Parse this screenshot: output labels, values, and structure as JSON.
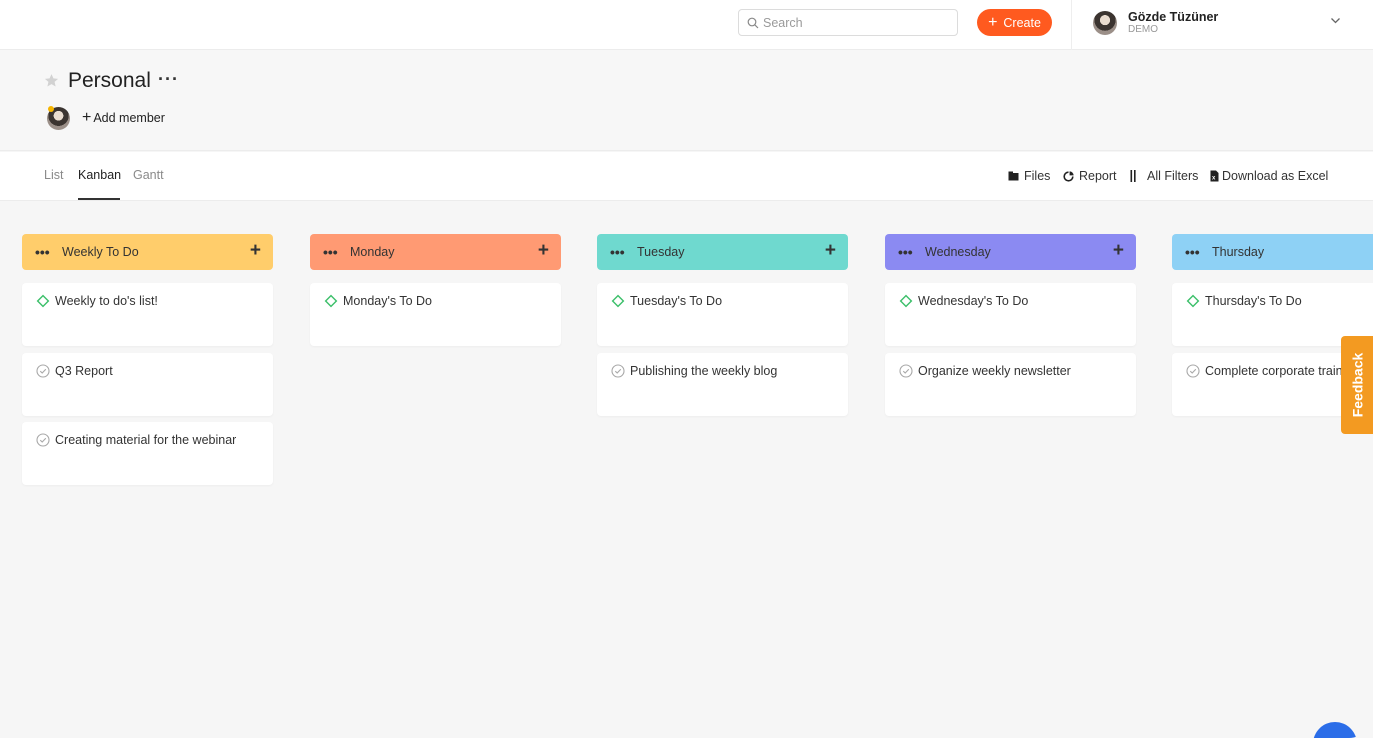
{
  "topbar": {
    "search_placeholder": "Search",
    "create_label": "Create",
    "user": {
      "name": "Gözde Tüzüner",
      "subtitle": "DEMO"
    }
  },
  "project": {
    "title": "Personal",
    "more": "···",
    "add_member_label": "Add member"
  },
  "tabs": [
    {
      "label": "List"
    },
    {
      "label": "Kanban",
      "active": true
    },
    {
      "label": "Gantt"
    }
  ],
  "toolbar": {
    "files": "Files",
    "report": "Report",
    "all_filters": "All Filters",
    "download": "Download as Excel"
  },
  "columns": [
    {
      "title": "Weekly To Do",
      "color": "#ffcd6b",
      "cards": [
        {
          "text": "Weekly to do's list!",
          "icon": "diamond-icon"
        },
        {
          "text": "Q3 Report",
          "icon": "check-circle-icon"
        },
        {
          "text": "Creating material for the webinar",
          "icon": "check-circle-icon"
        }
      ]
    },
    {
      "title": "Monday",
      "color": "#ff9a73",
      "cards": [
        {
          "text": "Monday's To Do",
          "icon": "diamond-icon"
        }
      ]
    },
    {
      "title": "Tuesday",
      "color": "#6fd9cf",
      "cards": [
        {
          "text": "Tuesday's To Do",
          "icon": "diamond-icon"
        },
        {
          "text": "Publishing the weekly blog",
          "icon": "check-circle-icon"
        }
      ]
    },
    {
      "title": "Wednesday",
      "color": "#8b8af2",
      "cards": [
        {
          "text": "Wednesday's To Do",
          "icon": "diamond-icon"
        },
        {
          "text": "Organize weekly newsletter",
          "icon": "check-circle-icon"
        }
      ]
    },
    {
      "title": "Thursday",
      "color": "#8ed1f5",
      "cards": [
        {
          "text": "Thursday's To Do",
          "icon": "diamond-icon"
        },
        {
          "text": "Complete corporate training",
          "icon": "check-circle-icon"
        }
      ]
    }
  ],
  "feedback_label": "Feedback",
  "colors": {
    "accent": "#ff5a1f",
    "feedback": "#f39a21",
    "diamond": "#3cbf6a"
  }
}
